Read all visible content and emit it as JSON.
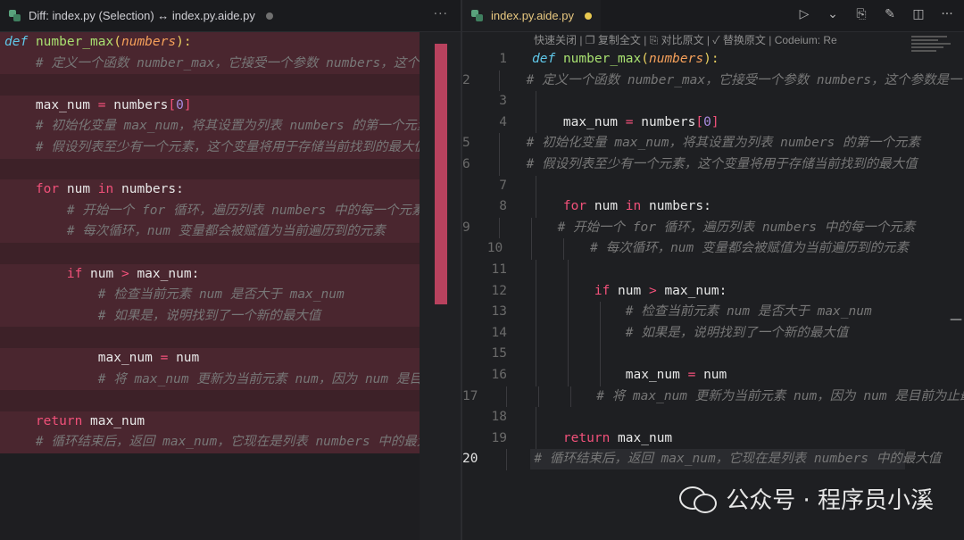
{
  "left_tab": {
    "title": "Diff: index.py (Selection) ↔ index.py.aide.py",
    "more": "···"
  },
  "right_tab": {
    "title": "index.py.aide.py",
    "more": "···"
  },
  "toolbar": {
    "run": "▷",
    "run_menu": "⌄",
    "compare": "⎘",
    "edit": "✎",
    "split": "◫",
    "more": "···"
  },
  "codeium_bar": {
    "close_icon": "✕",
    "text": "快速关闭 | ❐ 复制全文 | ⎘ 对比原文 | ✓ 替换原文 | Codeium: Re"
  },
  "code": {
    "l1_def": "def",
    "l1_name": "number_max",
    "l1_open": "(",
    "l1_param": "numbers",
    "l1_close": "):",
    "l2": "# 定义一个函数 number_max，它接受一个参数 numbers，这个参数是一个列表",
    "l4_var": "max_num",
    "l4_eq": "=",
    "l4_list": "numbers",
    "l4_idx": "0",
    "l5": "# 初始化变量 max_num，将其设置为列表 numbers 的第一个元素",
    "l6": "# 假设列表至少有一个元素，这个变量将用于存储当前找到的最大值",
    "l8_for": "for",
    "l8_var": "num",
    "l8_in": "in",
    "l8_list": "numbers",
    "l9": "# 开始一个 for 循环，遍历列表 numbers 中的每一个元素",
    "l10": "# 每次循环，num 变量都会被赋值为当前遍历到的元素",
    "l12_if": "if",
    "l12_a": "num",
    "l12_gt": ">",
    "l12_b": "max_num",
    "l13": "# 检查当前元素 num 是否大于 max_num",
    "l14": "# 如果是，说明找到了一个新的最大值",
    "l16_var": "max_num",
    "l16_eq": "=",
    "l16_val": "num",
    "l17": "# 将 max_num 更新为当前元素 num，因为 num 是目前为止最大的值",
    "l19_ret": "return",
    "l19_val": "max_num",
    "l20": "# 循环结束后，返回 max_num，它现在是列表 numbers 中的最大值"
  },
  "line_numbers": [
    "1",
    "2",
    "3",
    "4",
    "5",
    "6",
    "7",
    "8",
    "9",
    "10",
    "11",
    "12",
    "13",
    "14",
    "15",
    "16",
    "17",
    "18",
    "19",
    "20"
  ],
  "watermark": "公众号 · 程序员小溪"
}
